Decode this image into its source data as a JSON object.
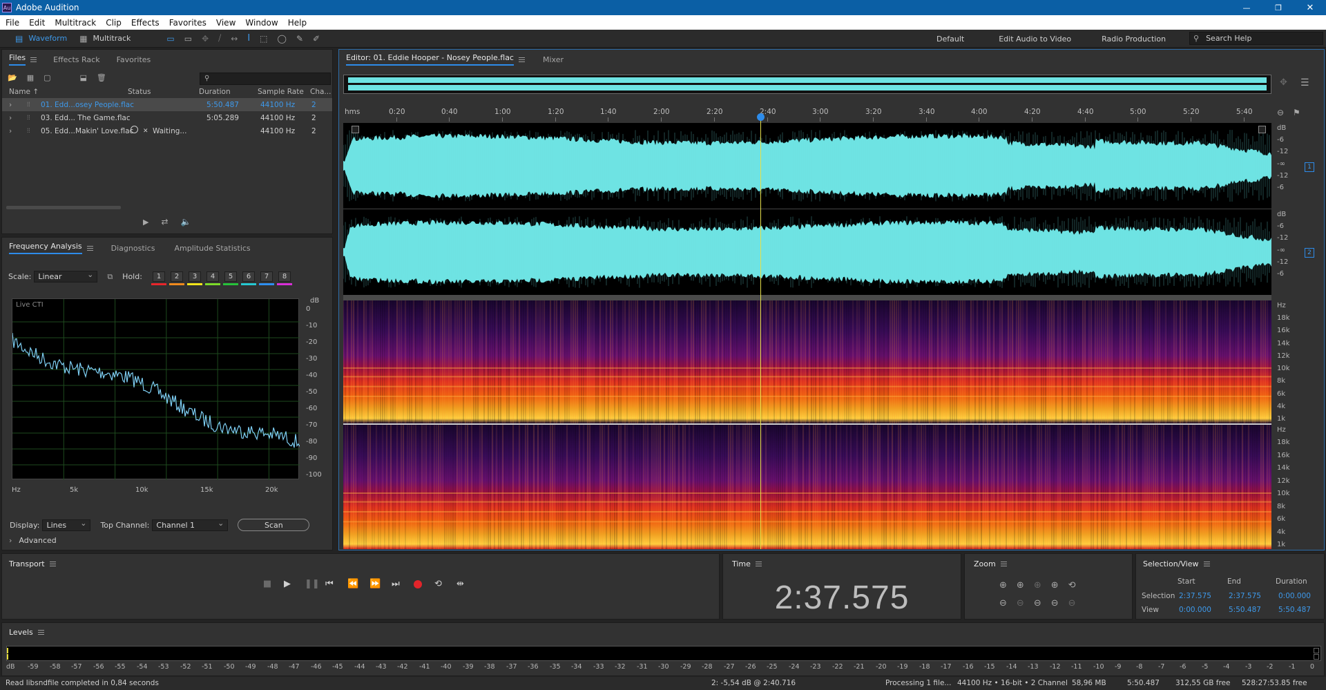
{
  "app": {
    "title": "Adobe Audition",
    "logo": "Au"
  },
  "menu": [
    "File",
    "Edit",
    "Multitrack",
    "Clip",
    "Effects",
    "Favorites",
    "View",
    "Window",
    "Help"
  ],
  "toolbar": {
    "waveform_label": "Waveform",
    "multitrack_label": "Multitrack",
    "workspaces": [
      "Default",
      "Edit Audio to Video",
      "Radio Production"
    ],
    "search_placeholder": "Search Help"
  },
  "files_panel": {
    "tabs": [
      "Files",
      "Effects Rack",
      "Favorites"
    ],
    "columns": [
      "Name ↑",
      "Status",
      "Duration",
      "Sample Rate",
      "Cha..."
    ],
    "rows": [
      {
        "name": "01. Edd...osey People.flac",
        "status": "",
        "duration": "5:50.487",
        "sample_rate": "44100 Hz",
        "channels": "2",
        "selected": true
      },
      {
        "name": "03. Edd... The Game.flac",
        "status": "",
        "duration": "5:05.289",
        "sample_rate": "44100 Hz",
        "channels": "2",
        "selected": false
      },
      {
        "name": "05. Edd...Makin' Love.flac",
        "status": "Waiting...",
        "duration": "",
        "sample_rate": "44100 Hz",
        "channels": "2",
        "selected": false
      }
    ]
  },
  "analysis_panel": {
    "tabs": [
      "Frequency Analysis",
      "Diagnostics",
      "Amplitude Statistics"
    ],
    "scale_label": "Scale:",
    "scale_value": "Linear",
    "hold_label": "Hold:",
    "hold_buttons": [
      "1",
      "2",
      "3",
      "4",
      "5",
      "6",
      "7",
      "8"
    ],
    "hold_colors": [
      "#e8262b",
      "#f08a1d",
      "#f2e51b",
      "#7ddb2a",
      "#27c23a",
      "#26c9d1",
      "#2e8ff0",
      "#d92fd8"
    ],
    "live_label": "Live CTI",
    "db_unit": "dB",
    "db_ticks": [
      "0",
      "-10",
      "-20",
      "-30",
      "-40",
      "-50",
      "-60",
      "-70",
      "-80",
      "-90",
      "-100"
    ],
    "hz_ticks": [
      "Hz",
      "5k",
      "10k",
      "15k",
      "20k"
    ],
    "display_label": "Display:",
    "display_value": "Lines",
    "top_channel_label": "Top Channel:",
    "top_channel_value": "Channel 1",
    "scan_label": "Scan",
    "advanced_label": "Advanced"
  },
  "editor": {
    "tab_title": "Editor: 01. Eddie Hooper - Nosey People.flac",
    "mixer_label": "Mixer",
    "time_unit": "hms",
    "time_ticks": [
      "0:20",
      "0:40",
      "1:00",
      "1:20",
      "1:40",
      "2:00",
      "2:20",
      "2:40",
      "3:00",
      "3:20",
      "3:40",
      "4:00",
      "4:20",
      "4:40",
      "5:00",
      "5:20",
      "5:40"
    ],
    "playhead_fraction": 0.4497,
    "db_scale": [
      "dB",
      "-6",
      "-12",
      "-∞",
      "-12",
      "-6"
    ],
    "channel_badges": [
      "1",
      "2"
    ],
    "hz_scale": [
      "Hz",
      "18k",
      "16k",
      "14k",
      "12k",
      "10k",
      "8k",
      "6k",
      "4k",
      "1k"
    ]
  },
  "transport": {
    "title": "Transport",
    "buttons": [
      "stop",
      "play",
      "pause",
      "go-to-start",
      "rewind",
      "fast-forward",
      "go-to-end",
      "record",
      "loop",
      "skip-selection"
    ]
  },
  "time_panel": {
    "title": "Time",
    "current": "2:37.575"
  },
  "zoom_panel": {
    "title": "Zoom"
  },
  "selection_panel": {
    "title": "Selection/View",
    "headers": [
      "Start",
      "End",
      "Duration"
    ],
    "selection": {
      "label": "Selection",
      "start": "2:37.575",
      "end": "2:37.575",
      "duration": "0:00.000"
    },
    "view": {
      "label": "View",
      "start": "0:00.000",
      "end": "5:50.487",
      "duration": "5:50.487"
    }
  },
  "levels": {
    "title": "Levels",
    "ticks": [
      "dB",
      "-59",
      "-58",
      "-57",
      "-56",
      "-55",
      "-54",
      "-53",
      "-52",
      "-51",
      "-50",
      "-49",
      "-48",
      "-47",
      "-46",
      "-45",
      "-44",
      "-43",
      "-42",
      "-41",
      "-40",
      "-39",
      "-38",
      "-37",
      "-36",
      "-35",
      "-34",
      "-33",
      "-32",
      "-31",
      "-30",
      "-29",
      "-28",
      "-27",
      "-26",
      "-25",
      "-24",
      "-23",
      "-22",
      "-21",
      "-20",
      "-19",
      "-18",
      "-17",
      "-16",
      "-15",
      "-14",
      "-13",
      "-12",
      "-11",
      "-10",
      "-9",
      "-8",
      "-7",
      "-6",
      "-5",
      "-4",
      "-3",
      "-2",
      "-1",
      "0"
    ]
  },
  "status_bar": {
    "message": "Read libsndfile completed in 0,84 seconds",
    "cursor_info": "2: -5,54 dB @ 2:40.716",
    "processing": "Processing 1 file...",
    "format": "44100 Hz • 16-bit • 2 Channel",
    "size": "58,96 MB",
    "duration": "5:50.487",
    "free_space": "312,55 GB free",
    "free_time": "528:27:53.85 free"
  }
}
